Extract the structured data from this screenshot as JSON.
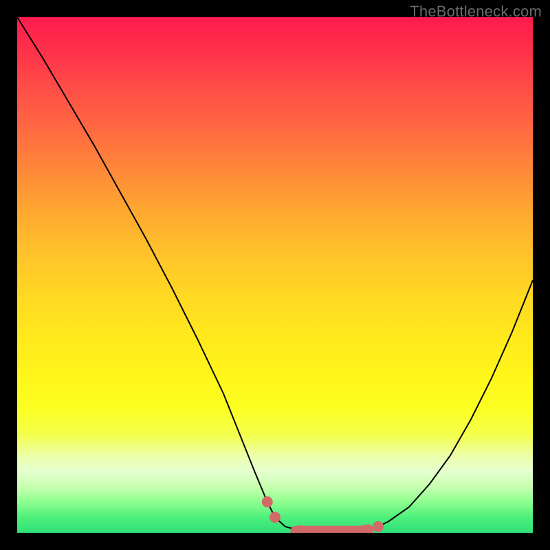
{
  "watermark": "TheBottleneck.com",
  "colors": {
    "background": "#000000",
    "curve_stroke": "#000000",
    "data_points": "#d26a68",
    "gradient_top": "#ff1a4e",
    "gradient_bottom": "#2fe07a"
  },
  "chart_data": {
    "type": "line",
    "title": "",
    "xlabel": "",
    "ylabel": "",
    "xlim": [
      0,
      100
    ],
    "ylim": [
      0,
      100
    ],
    "grid": false,
    "legend": false,
    "series": [
      {
        "name": "bottleneck-curve",
        "x": [
          0,
          5,
          10,
          15,
          20,
          25,
          30,
          35,
          40,
          42,
          44,
          46,
          48.5,
          50,
          52,
          55,
          59,
          62,
          65,
          68,
          70,
          72,
          76,
          80,
          84,
          88,
          92,
          96,
          100
        ],
        "values": [
          100,
          92,
          83.5,
          75,
          66,
          57,
          47.5,
          37.5,
          27,
          22,
          17,
          12,
          6,
          3,
          1.2,
          0.4,
          0,
          0,
          0.2,
          0.6,
          1.2,
          2.2,
          5,
          9.5,
          15,
          22,
          30,
          39,
          49
        ]
      }
    ],
    "data_markers": {
      "name": "highlighted-points",
      "x": [
        48.5,
        50,
        55,
        57,
        59,
        61,
        63,
        65,
        67,
        68,
        70
      ],
      "values": [
        6,
        3,
        0.4,
        0.3,
        0,
        0,
        0,
        0.2,
        0.4,
        0.6,
        1.2
      ]
    },
    "flat_bar": {
      "x_start": 53,
      "x_end": 69,
      "y": 0.3
    }
  }
}
